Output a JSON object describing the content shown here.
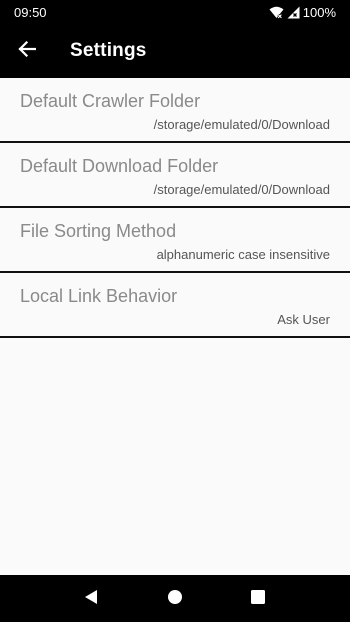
{
  "status_bar": {
    "time": "09:50",
    "battery_text": "100%"
  },
  "app_bar": {
    "title": "Settings",
    "back_icon": "arrow-left-icon"
  },
  "preferences": [
    {
      "title": "Default Crawler Folder",
      "summary": "/storage/emulated/0/Download"
    },
    {
      "title": "Default Download Folder",
      "summary": "/storage/emulated/0/Download"
    },
    {
      "title": "File Sorting Method",
      "summary": "alphanumeric case insensitive"
    },
    {
      "title": "Local Link Behavior",
      "summary": "Ask User"
    }
  ],
  "nav_bar": {
    "back_icon": "triangle-back-icon",
    "home_icon": "circle-home-icon",
    "recents_icon": "square-recents-icon"
  },
  "colors": {
    "bar_background": "#000000",
    "page_background": "#fafafa",
    "pref_title": "#8a8a8a",
    "pref_summary": "#555555"
  }
}
